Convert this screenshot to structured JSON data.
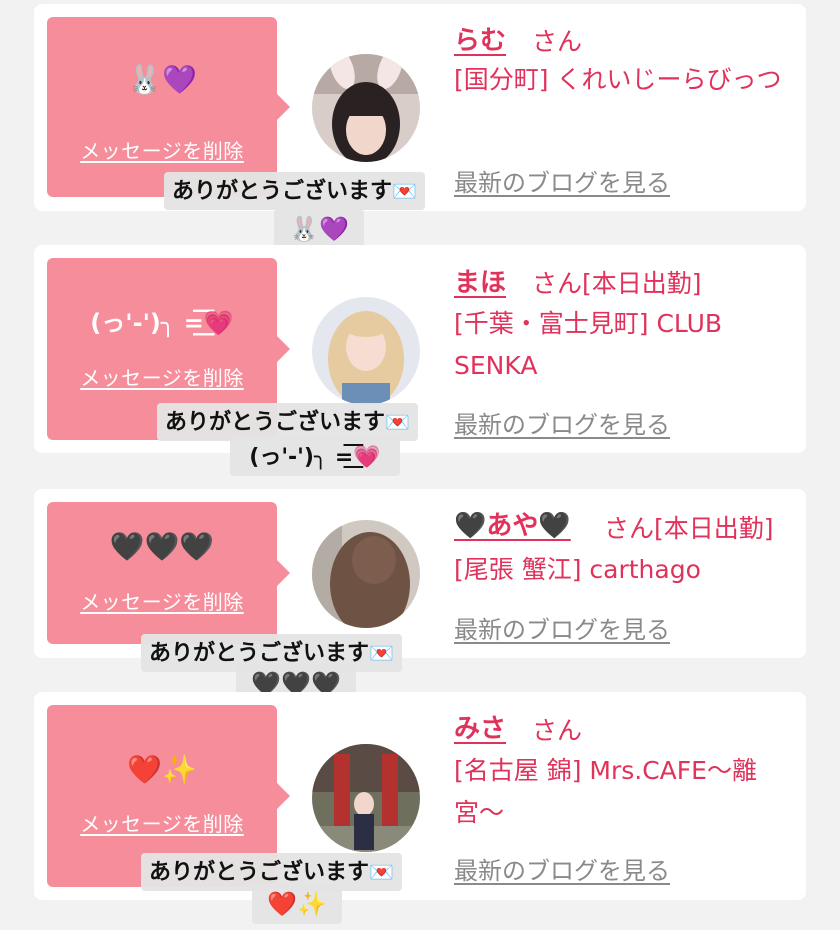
{
  "delete_label": "メッセージを削除",
  "blog_label": "最新のブログを見る",
  "suffix": "さん",
  "toast_text": "ありがとうございます",
  "envelope_glyph": "💌",
  "accent": "#e0325a",
  "bubble_color": "#f68d9a",
  "entries": [
    {
      "message": "🐰💜",
      "name": "らむ",
      "status": "",
      "shop": "[国分町] くれいじーらびっつ",
      "toast_emoji": "🐰💜"
    },
    {
      "message": "(っ'-')╮ =͟͟͞͞💗",
      "name": "まほ",
      "status": "[本日出勤]",
      "shop": "[千葉・富士見町] CLUB SENKA",
      "toast_emoji": "(っ'-')╮ =͟͟͞͞💗"
    },
    {
      "message": "🖤🖤🖤",
      "name": "🖤あや🖤",
      "status": "[本日出勤]",
      "shop": "[尾張 蟹江] carthago",
      "toast_emoji": "🖤🖤🖤"
    },
    {
      "message": "❤️✨",
      "name": "みさ",
      "status": "",
      "shop": "[名古屋 錦] Mrs.CAFE〜離宮〜",
      "toast_emoji": "❤️✨"
    }
  ]
}
